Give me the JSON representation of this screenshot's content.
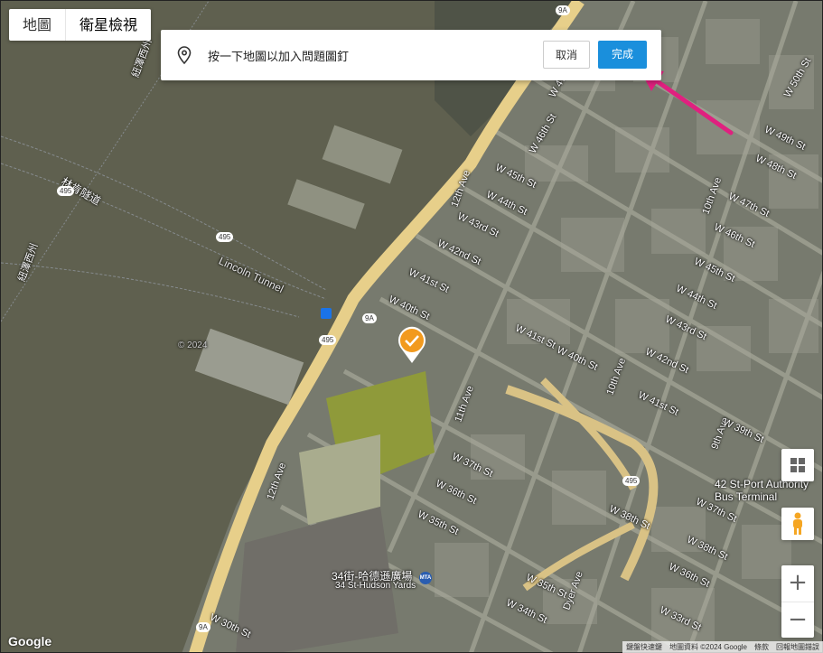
{
  "map_type": {
    "map_label": "地圖",
    "satellite_label": "衛星檢視"
  },
  "prompt": {
    "instruction": "按一下地圖以加入問題圖釘",
    "cancel_label": "取消",
    "done_label": "完成"
  },
  "labels": {
    "lincoln_tunnel_cn": "林肯隧道",
    "lincoln_tunnel": "Lincoln Tunnel",
    "nj_river": "紐澤西州",
    "nj_river2": "紐澤西州",
    "twelfth_ave_top": "12th Ave",
    "twelfth_ave_bottom": "12th Ave",
    "eleventh_ave": "11th Ave",
    "tenth_ave_top": "10th Ave",
    "tenth_ave_mid": "10th Ave",
    "ninth_ave": "9th Ave",
    "dyer_ave": "Dyer Ave",
    "w47": "W 47th St",
    "w46": "W 46th St",
    "w45": "W 45th St",
    "w44": "W 44th St",
    "w43": "W 43rd St",
    "w42": "W 42nd St",
    "w41": "W 41st St",
    "w40": "W 40th St",
    "w41b": "W 41st St",
    "w40b": "W 40th St",
    "w38": "W 38th St",
    "w37": "W 37th St",
    "w36": "W 36th St",
    "w35": "W 35th St",
    "w30": "W 30th St",
    "w50": "W 50th St",
    "w49": "W 49th St",
    "w48": "W 48th St",
    "w47r": "W 47th St",
    "w46r": "W 46th St",
    "w45r": "W 45th St",
    "w44r": "W 44th St",
    "w43r": "W 43rd St",
    "w42r": "W 42nd St",
    "w41r": "W 41st St",
    "w39r": "W 39th St",
    "w38r": "W 38th St",
    "w37r": "W 37th St",
    "w36r": "W 36th St",
    "w35r": "W 35th St",
    "w34": "W 34th St",
    "w33": "W 33rd St",
    "port_authority": "42 St-Port Authority\nBus Terminal",
    "hudson_yards_cn": "34街-哈德遜廣場",
    "hudson_yards": "34 St-Hudson Yards",
    "copyright": "© 2024"
  },
  "shields": [
    "495",
    "495",
    "495",
    "9A",
    "495",
    "9A",
    "9A",
    "495"
  ],
  "footer": [
    "鍵盤快速鍵",
    "地圖資料 ©2024 Google",
    "條款",
    "回報地圖錯誤"
  ],
  "google_logo": "Google",
  "colors": {
    "done_button": "#1a8fdc",
    "marker": "#f29a1e",
    "highway": "#e7cf8a",
    "arrow": "#e0207f"
  }
}
